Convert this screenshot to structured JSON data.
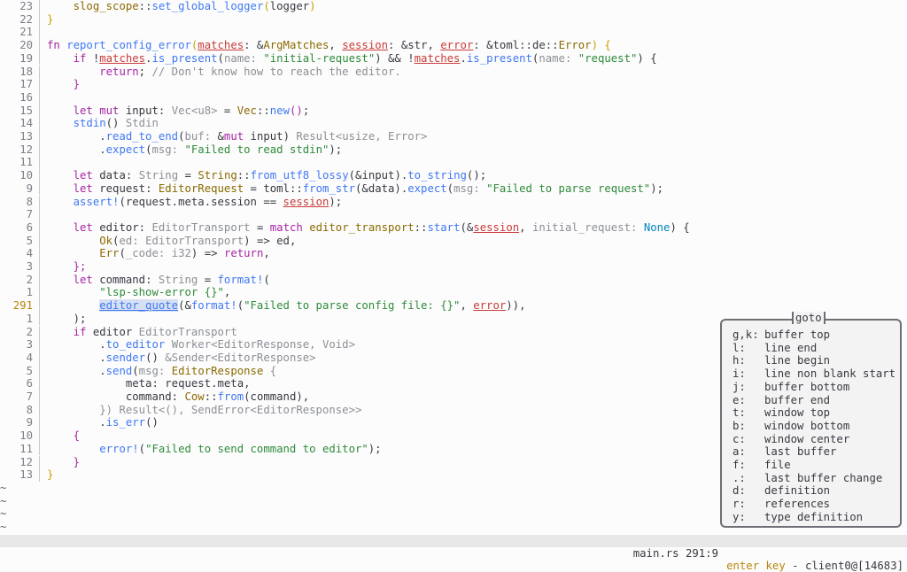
{
  "editor": {
    "lines": [
      {
        "n": "23",
        "t": [
          [
            "    ",
            ""
          ],
          [
            "slog_scope",
            "ty"
          ],
          [
            "::",
            ""
          ],
          [
            "set_global_logger",
            "fnn"
          ],
          [
            "(",
            "pu"
          ],
          [
            "logger",
            ""
          ],
          [
            ")",
            "pu"
          ]
        ]
      },
      {
        "n": "22",
        "t": [
          [
            "}",
            "pu"
          ]
        ]
      },
      {
        "n": "21",
        "t": []
      },
      {
        "n": "20",
        "t": [
          [
            "fn ",
            "k"
          ],
          [
            "report_config_error",
            "fnn"
          ],
          [
            "(",
            "pu"
          ],
          [
            "matches",
            "ptr"
          ],
          [
            ": &",
            ""
          ],
          [
            "ArgMatches",
            "ty"
          ],
          [
            ", ",
            ""
          ],
          [
            "session",
            "ptr"
          ],
          [
            ": &str, ",
            ""
          ],
          [
            "error",
            "ptr"
          ],
          [
            ": &toml",
            ""
          ],
          [
            "::",
            ""
          ],
          [
            "de",
            ""
          ],
          [
            "::",
            ""
          ],
          [
            "Error",
            "ty"
          ],
          [
            ") {",
            "pu"
          ]
        ]
      },
      {
        "n": "19",
        "t": [
          [
            "    ",
            ""
          ],
          [
            "if ",
            "k"
          ],
          [
            "!",
            ""
          ],
          [
            "matches",
            "ptr"
          ],
          [
            ".",
            ""
          ],
          [
            "is_present",
            "fnn"
          ],
          [
            "(",
            ""
          ],
          [
            "name: ",
            "hint"
          ],
          [
            "\"initial-request\"",
            "st"
          ],
          [
            ") && !",
            ""
          ],
          [
            "matches",
            "ptr"
          ],
          [
            ".",
            ""
          ],
          [
            "is_present",
            "fnn"
          ],
          [
            "(",
            ""
          ],
          [
            "name: ",
            "hint"
          ],
          [
            "\"request\"",
            "st"
          ],
          [
            ") {",
            ""
          ]
        ]
      },
      {
        "n": "18",
        "t": [
          [
            "        ",
            ""
          ],
          [
            "return",
            "k"
          ],
          [
            "; ",
            ""
          ],
          [
            "// Don't know how to reach the editor.",
            "cm"
          ]
        ]
      },
      {
        "n": "17",
        "t": [
          [
            "    ",
            ""
          ],
          [
            "}",
            "ma"
          ]
        ]
      },
      {
        "n": "16",
        "t": []
      },
      {
        "n": "15",
        "t": [
          [
            "    ",
            ""
          ],
          [
            "let mut ",
            "k"
          ],
          [
            "input",
            ""
          ],
          [
            ": ",
            ""
          ],
          [
            "Vec<u8>",
            "hint"
          ],
          [
            " = ",
            ""
          ],
          [
            "Vec",
            "ty"
          ],
          [
            "::",
            ""
          ],
          [
            "new",
            "fnn"
          ],
          [
            "()",
            "ma"
          ],
          [
            ";",
            ""
          ]
        ]
      },
      {
        "n": "14",
        "t": [
          [
            "    ",
            ""
          ],
          [
            "stdin",
            "fnn"
          ],
          [
            "() ",
            ""
          ],
          [
            "Stdin",
            "hint"
          ]
        ]
      },
      {
        "n": "13",
        "t": [
          [
            "        .",
            ""
          ],
          [
            "read_to_end",
            "fnn"
          ],
          [
            "(",
            ""
          ],
          [
            "buf: ",
            "hint"
          ],
          [
            "&",
            ""
          ],
          [
            "mut ",
            "k"
          ],
          [
            "input",
            ""
          ],
          [
            ") ",
            ""
          ],
          [
            "Result<usize, Error>",
            "hint"
          ]
        ]
      },
      {
        "n": "12",
        "t": [
          [
            "        .",
            ""
          ],
          [
            "expect",
            "fnn"
          ],
          [
            "(",
            ""
          ],
          [
            "msg: ",
            "hint"
          ],
          [
            "\"Failed to read stdin\"",
            "st"
          ],
          [
            ");",
            ""
          ]
        ]
      },
      {
        "n": "11",
        "t": []
      },
      {
        "n": "10",
        "t": [
          [
            "    ",
            ""
          ],
          [
            "let ",
            "k"
          ],
          [
            "data",
            ""
          ],
          [
            ": ",
            ""
          ],
          [
            "String",
            "hint"
          ],
          [
            " = ",
            ""
          ],
          [
            "String",
            "ty"
          ],
          [
            "::",
            ""
          ],
          [
            "from_utf8_lossy",
            "fnn"
          ],
          [
            "(&",
            ""
          ],
          [
            "input",
            ""
          ],
          [
            ").",
            ""
          ],
          [
            "to_string",
            "fnn"
          ],
          [
            "();",
            ""
          ]
        ]
      },
      {
        "n": "9",
        "t": [
          [
            "    ",
            ""
          ],
          [
            "let ",
            "k"
          ],
          [
            "request",
            ""
          ],
          [
            ": ",
            ""
          ],
          [
            "EditorRequest",
            "ty"
          ],
          [
            " = toml",
            ""
          ],
          [
            "::",
            ""
          ],
          [
            "from_str",
            "fnn"
          ],
          [
            "(&data).",
            ""
          ],
          [
            "expect",
            "fnn"
          ],
          [
            "(",
            ""
          ],
          [
            "msg: ",
            "hint"
          ],
          [
            "\"Failed to parse request\"",
            "st"
          ],
          [
            ");",
            ""
          ]
        ]
      },
      {
        "n": "8",
        "t": [
          [
            "    ",
            ""
          ],
          [
            "assert!",
            "fnn"
          ],
          [
            "(request.meta.session == ",
            ""
          ],
          [
            "session",
            "ptr"
          ],
          [
            ");",
            ""
          ]
        ]
      },
      {
        "n": "7",
        "t": []
      },
      {
        "n": "6",
        "t": [
          [
            "    ",
            ""
          ],
          [
            "let ",
            "k"
          ],
          [
            "editor",
            ""
          ],
          [
            ": ",
            ""
          ],
          [
            "EditorTransport",
            "hint"
          ],
          [
            " = ",
            ""
          ],
          [
            "match ",
            "k"
          ],
          [
            "editor_transport",
            "ty"
          ],
          [
            "::",
            ""
          ],
          [
            "start",
            "fnn"
          ],
          [
            "(&",
            ""
          ],
          [
            "session",
            "ptr"
          ],
          [
            ", ",
            ""
          ],
          [
            "initial_request: ",
            "hint"
          ],
          [
            "None",
            "nn"
          ],
          [
            ") {",
            ""
          ]
        ]
      },
      {
        "n": "5",
        "t": [
          [
            "        ",
            ""
          ],
          [
            "Ok",
            "ty"
          ],
          [
            "(",
            ""
          ],
          [
            "ed: ",
            "hint"
          ],
          [
            "EditorTransport",
            "hint"
          ],
          [
            ") => ed,",
            ""
          ]
        ]
      },
      {
        "n": "4",
        "t": [
          [
            "        ",
            ""
          ],
          [
            "Err",
            "ty"
          ],
          [
            "(",
            ""
          ],
          [
            "_code: ",
            "hint"
          ],
          [
            "i32",
            "hint"
          ],
          [
            ") => ",
            ""
          ],
          [
            "return",
            "k"
          ],
          [
            ",",
            ""
          ]
        ]
      },
      {
        "n": "3",
        "t": [
          [
            "    ",
            ""
          ],
          [
            "};",
            "ma"
          ]
        ]
      },
      {
        "n": "2",
        "t": [
          [
            "    ",
            ""
          ],
          [
            "let ",
            "k"
          ],
          [
            "command",
            ""
          ],
          [
            ": ",
            ""
          ],
          [
            "String",
            "hint"
          ],
          [
            " = ",
            ""
          ],
          [
            "format!",
            "fnn"
          ],
          [
            "(",
            ""
          ]
        ]
      },
      {
        "n": "1",
        "t": [
          [
            "        ",
            ""
          ],
          [
            "\"lsp-show-error {}\"",
            "st"
          ],
          [
            ",",
            ""
          ]
        ]
      },
      {
        "n": "291",
        "cur": true,
        "t": [
          [
            "        ",
            ""
          ],
          [
            "editor_quote",
            "sel"
          ],
          [
            "(&",
            ""
          ],
          [
            "format!",
            "fnn"
          ],
          [
            "(",
            ""
          ],
          [
            "\"Failed to parse config file: {}\"",
            "st"
          ],
          [
            ", ",
            ""
          ],
          [
            "error",
            "ptr"
          ],
          [
            ")),",
            ""
          ]
        ]
      },
      {
        "n": "1",
        "t": [
          [
            "    );",
            ""
          ]
        ]
      },
      {
        "n": "2",
        "t": [
          [
            "    ",
            ""
          ],
          [
            "if ",
            "k"
          ],
          [
            "editor ",
            ""
          ],
          [
            "EditorTransport",
            "hint"
          ]
        ]
      },
      {
        "n": "3",
        "t": [
          [
            "        .",
            ""
          ],
          [
            "to_editor",
            "fnn"
          ],
          [
            " ",
            ""
          ],
          [
            "Worker<EditorResponse, Void>",
            "hint"
          ]
        ]
      },
      {
        "n": "4",
        "t": [
          [
            "        .",
            ""
          ],
          [
            "sender",
            "fnn"
          ],
          [
            "() ",
            ""
          ],
          [
            "&Sender<EditorResponse>",
            "hint"
          ]
        ]
      },
      {
        "n": "5",
        "t": [
          [
            "        .",
            ""
          ],
          [
            "send",
            "fnn"
          ],
          [
            "(",
            ""
          ],
          [
            "msg: ",
            "hint"
          ],
          [
            "EditorResponse",
            "ty"
          ],
          [
            " {",
            "hint"
          ]
        ]
      },
      {
        "n": "6",
        "t": [
          [
            "            meta: request.meta,",
            ""
          ]
        ]
      },
      {
        "n": "7",
        "t": [
          [
            "            command: ",
            ""
          ],
          [
            "Cow",
            "ty"
          ],
          [
            "::",
            ""
          ],
          [
            "from",
            "fnn"
          ],
          [
            "(command),",
            ""
          ]
        ]
      },
      {
        "n": "8",
        "t": [
          [
            "        ",
            ""
          ],
          [
            "})",
            "hint"
          ],
          [
            " ",
            ""
          ],
          [
            "Result<(), SendError<EditorResponse>>",
            "hint"
          ]
        ]
      },
      {
        "n": "9",
        "t": [
          [
            "        .",
            ""
          ],
          [
            "is_err",
            "fnn"
          ],
          [
            "()",
            ""
          ]
        ]
      },
      {
        "n": "10",
        "t": [
          [
            "    ",
            ""
          ],
          [
            "{",
            "ma"
          ]
        ]
      },
      {
        "n": "11",
        "t": [
          [
            "        ",
            ""
          ],
          [
            "error!",
            "fnn"
          ],
          [
            "(",
            ""
          ],
          [
            "\"Failed to send command to editor\"",
            "st"
          ],
          [
            ");",
            ""
          ]
        ]
      },
      {
        "n": "12",
        "t": [
          [
            "    ",
            ""
          ],
          [
            "}",
            "ma"
          ]
        ]
      },
      {
        "n": "13",
        "t": [
          [
            "}",
            "pu"
          ]
        ]
      }
    ],
    "tildes": [
      "~",
      "~",
      "~",
      "~"
    ]
  },
  "goto_menu": {
    "title": "goto",
    "items": [
      {
        "key": "g,k:",
        "label": "buffer top"
      },
      {
        "key": "l:",
        "label": "line end"
      },
      {
        "key": "h:",
        "label": "line begin"
      },
      {
        "key": "i:",
        "label": "line non blank start"
      },
      {
        "key": "j:",
        "label": "buffer bottom"
      },
      {
        "key": "e:",
        "label": "buffer end"
      },
      {
        "key": "t:",
        "label": "window top"
      },
      {
        "key": "b:",
        "label": "window bottom"
      },
      {
        "key": "c:",
        "label": "window center"
      },
      {
        "key": "a:",
        "label": "last buffer"
      },
      {
        "key": "f:",
        "label": "file"
      },
      {
        "key": ".:",
        "label": "last buffer change"
      },
      {
        "key": "d:",
        "label": "definition"
      },
      {
        "key": "r:",
        "label": "references"
      },
      {
        "key": "y:",
        "label": "type definition"
      }
    ]
  },
  "statusbar": {
    "file_position": "main.rs 291:9",
    "mode": "enter key",
    "client": " - client0@[14683]"
  }
}
